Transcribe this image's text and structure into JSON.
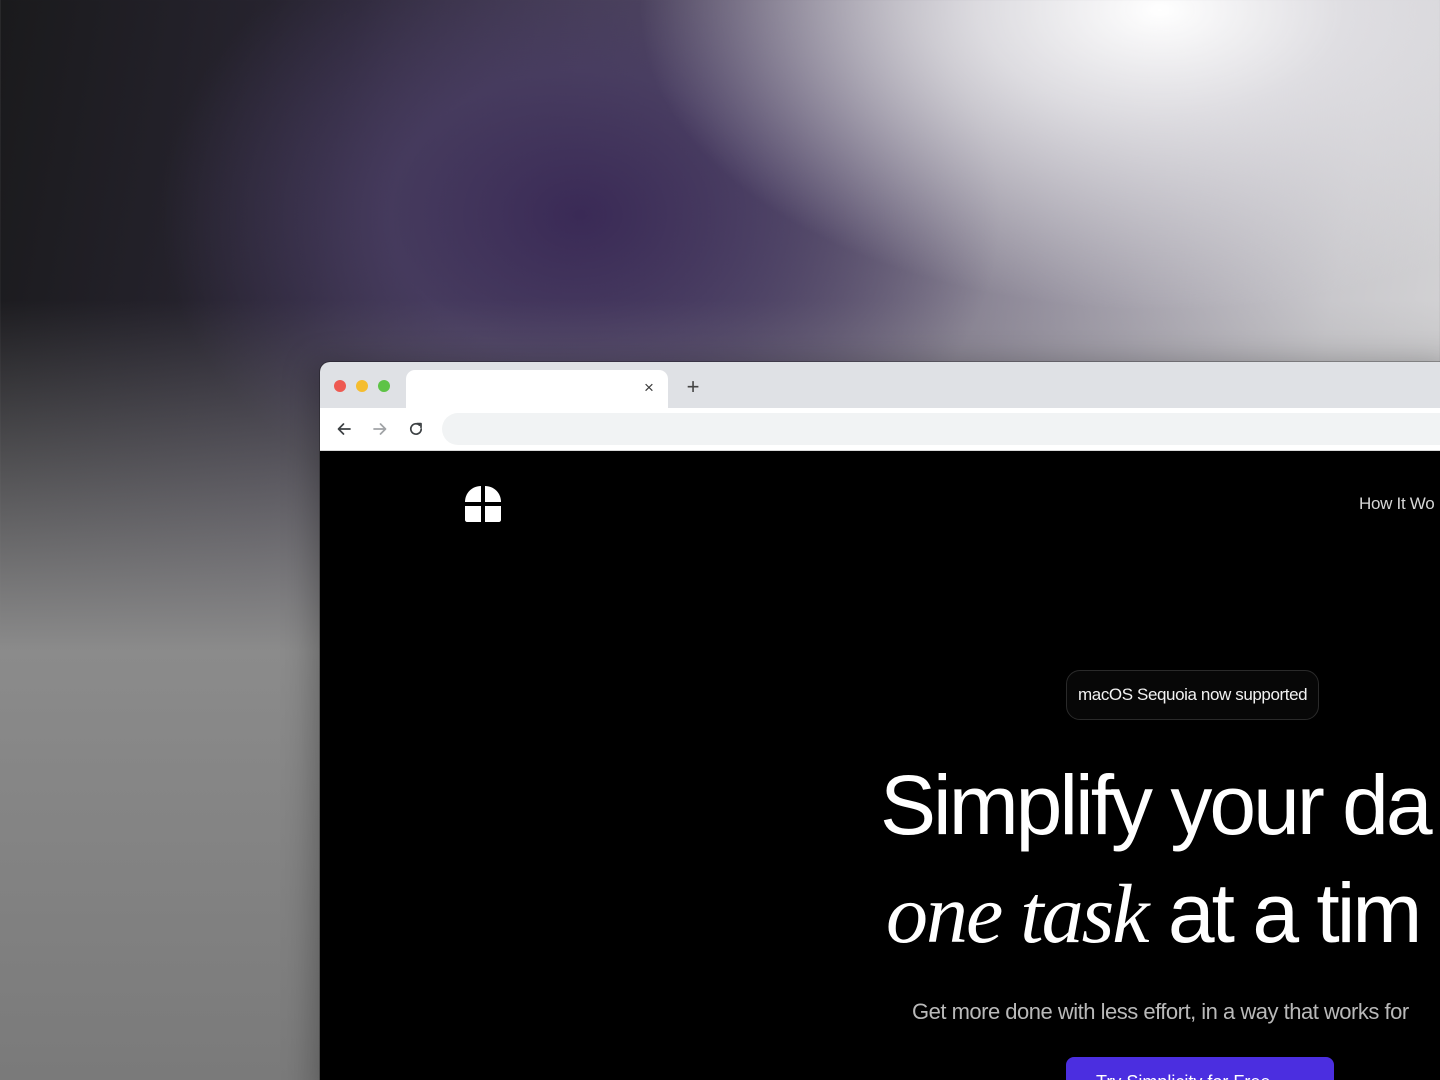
{
  "browser": {
    "tab": {
      "title": "",
      "close_glyph": "×"
    },
    "new_tab_glyph": "+",
    "address_bar": {
      "value": ""
    }
  },
  "site": {
    "nav": {
      "links": [
        "How It Wo"
      ]
    },
    "hero": {
      "badge": "macOS Sequoia now supported",
      "headline_line1": "Simplify your da",
      "headline_italic": "one task",
      "headline_rest": " at a tim",
      "subtitle": "Get more done with less effort, in a way that works for",
      "cta_label": "Try Simplicity for Free"
    }
  },
  "colors": {
    "accent": "#4b2ee0",
    "page_background": "#000000"
  },
  "icons": [
    "logo-icon",
    "back-arrow-icon",
    "forward-arrow-icon",
    "reload-icon",
    "close-icon",
    "plus-icon"
  ]
}
